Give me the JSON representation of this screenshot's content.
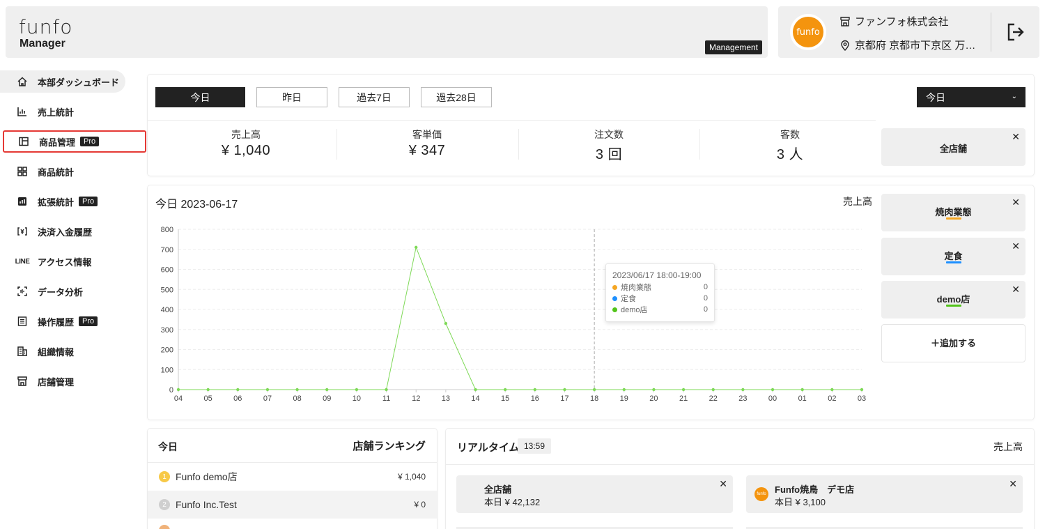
{
  "header": {
    "logo_top": "funfo",
    "logo_bottom": "Manager",
    "badge": "Management",
    "avatar_text": "funfo",
    "company": "ファンフォ株式会社",
    "address": "京都府 京都市下京区 万…"
  },
  "sidebar": {
    "items": [
      {
        "label": "本部ダッシュボード",
        "icon": "home-icon"
      },
      {
        "label": "売上統計",
        "icon": "bar-chart-icon"
      },
      {
        "label": "商品管理",
        "icon": "layout-icon",
        "badge": "Pro"
      },
      {
        "label": "商品統計",
        "icon": "grid-icon"
      },
      {
        "label": "拡張統計",
        "icon": "stats-icon",
        "badge": "Pro"
      },
      {
        "label": "決済入金履歴",
        "icon": "payment-icon"
      },
      {
        "label": "アクセス情報",
        "icon": "line-icon",
        "icon_text": "LINE"
      },
      {
        "label": "データ分析",
        "icon": "scan-icon"
      },
      {
        "label": "操作履歴",
        "icon": "list-icon",
        "badge": "Pro"
      },
      {
        "label": "組織情報",
        "icon": "building-icon"
      },
      {
        "label": "店舗管理",
        "icon": "store-icon"
      }
    ]
  },
  "summary": {
    "periods": [
      "今日",
      "昨日",
      "過去7日",
      "過去28日"
    ],
    "active_period": "今日",
    "range_select": "今日",
    "metrics": [
      {
        "label": "売上高",
        "value": "¥ 1,040"
      },
      {
        "label": "客単価",
        "value": "¥ 347"
      },
      {
        "label": "注文数",
        "value": "3 回"
      },
      {
        "label": "客数",
        "value": "3 人"
      }
    ],
    "all_stores": "全店舗"
  },
  "chart": {
    "title": "今日 2023-06-17",
    "metric": "売上高",
    "tooltip": {
      "title": "2023/06/17 18:00-19:00",
      "rows": [
        {
          "name": "焼肉業態",
          "value": "0",
          "color": "#f5a623"
        },
        {
          "name": "定食",
          "value": "0",
          "color": "#1e90ff"
        },
        {
          "name": "demo店",
          "value": "0",
          "color": "#52c41a"
        }
      ]
    },
    "stores": [
      {
        "name": "焼肉業態",
        "color": "#f5a623"
      },
      {
        "name": "定食",
        "color": "#1e90ff"
      },
      {
        "name": "demo店",
        "color": "#52c41a"
      }
    ],
    "add_label": "＋追加する"
  },
  "chart_data": {
    "type": "line",
    "title": "今日 2023-06-17",
    "xlabel": "",
    "ylabel": "",
    "ylim": [
      0,
      800
    ],
    "yticks": [
      0,
      100,
      200,
      300,
      400,
      500,
      600,
      700,
      800
    ],
    "x": [
      "04",
      "05",
      "06",
      "07",
      "08",
      "09",
      "10",
      "11",
      "12",
      "13",
      "14",
      "15",
      "16",
      "17",
      "18",
      "19",
      "20",
      "21",
      "22",
      "23",
      "00",
      "01",
      "02",
      "03"
    ],
    "series": [
      {
        "name": "demo店",
        "color": "#7ed957",
        "values": [
          0,
          0,
          0,
          0,
          0,
          0,
          0,
          0,
          710,
          330,
          0,
          0,
          0,
          0,
          0,
          0,
          0,
          0,
          0,
          0,
          0,
          0,
          0,
          0
        ]
      }
    ],
    "hover_x": "18",
    "grid": true
  },
  "ranking": {
    "title": "今日",
    "subtitle": "店舗ランキング",
    "rows": [
      {
        "rank": "1",
        "name": "Funfo demo店",
        "value": "¥ 1,040",
        "medal_color": "#f7c948"
      },
      {
        "rank": "2",
        "name": "Funfo Inc.Test",
        "value": "¥ 0",
        "medal_color": "#cfcfcf"
      }
    ]
  },
  "realtime": {
    "title": "リアルタイム",
    "time": "13:59",
    "metric": "売上高",
    "cards": [
      {
        "name": "全店舗",
        "value": "本日 ¥ 42,132"
      },
      {
        "name": "Funfo焼鳥　デモ店",
        "value": "本日 ¥ 3,100",
        "avatar": "funfo"
      }
    ]
  }
}
